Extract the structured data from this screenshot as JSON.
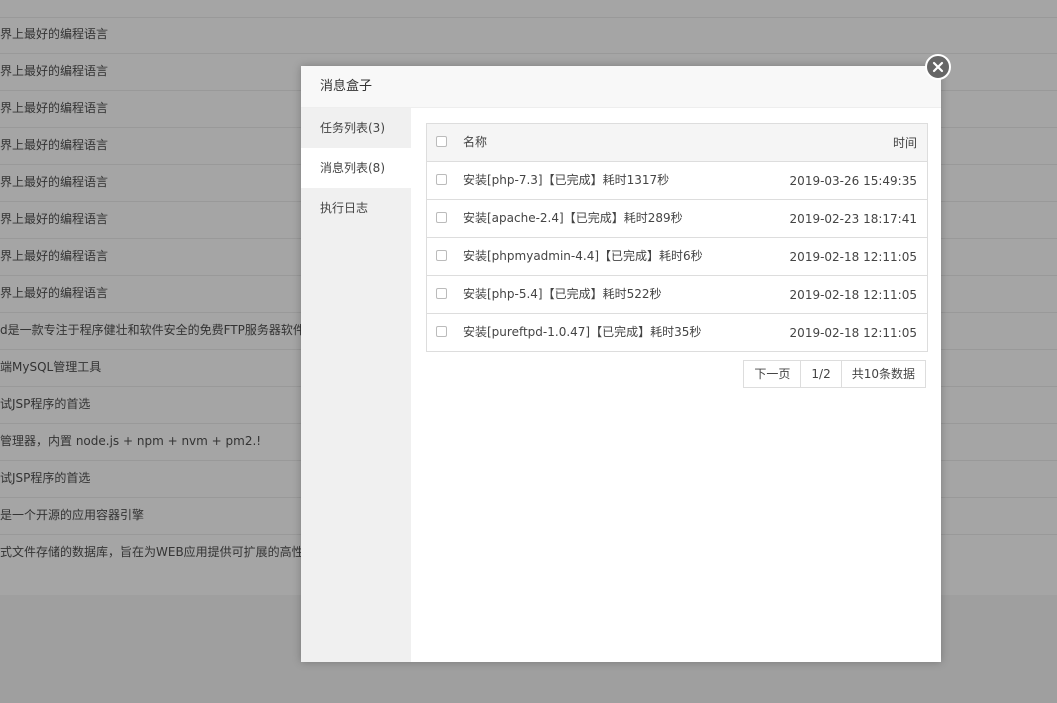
{
  "background": {
    "rows": [
      "界上最好的编程语言",
      "界上最好的编程语言",
      "界上最好的编程语言",
      "界上最好的编程语言",
      "界上最好的编程语言",
      "界上最好的编程语言",
      "界上最好的编程语言",
      "界上最好的编程语言",
      "d是一款专注于程序健壮和软件安全的免费FTP服务器软件",
      "端MySQL管理工具",
      "试JSP程序的首选",
      "管理器，内置 node.js + npm + nvm + pm2.!",
      "试JSP程序的首选",
      "是一个开源的应用容器引擎",
      "式文件存储的数据库，旨在为WEB应用提供可扩展的高性"
    ]
  },
  "modal": {
    "title": "消息盒子",
    "close_icon": "close-icon",
    "tabs": [
      {
        "label": "任务列表(3)",
        "active": false
      },
      {
        "label": "消息列表(8)",
        "active": true
      },
      {
        "label": "执行日志",
        "active": false
      }
    ],
    "table": {
      "header": {
        "name": "名称",
        "time": "时间"
      },
      "rows": [
        {
          "name": "安装[php-7.3]【已完成】耗时1317秒",
          "time": "2019-03-26 15:49:35"
        },
        {
          "name": "安装[apache-2.4]【已完成】耗时289秒",
          "time": "2019-02-23 18:17:41"
        },
        {
          "name": "安装[phpmyadmin-4.4]【已完成】耗时6秒",
          "time": "2019-02-18 12:11:05"
        },
        {
          "name": "安装[php-5.4]【已完成】耗时522秒",
          "time": "2019-02-18 12:11:05"
        },
        {
          "name": "安装[pureftpd-1.0.47]【已完成】耗时35秒",
          "time": "2019-02-18 12:11:05"
        }
      ]
    },
    "pager": {
      "next": "下一页",
      "page": "1/2",
      "total": "共10条数据"
    }
  }
}
